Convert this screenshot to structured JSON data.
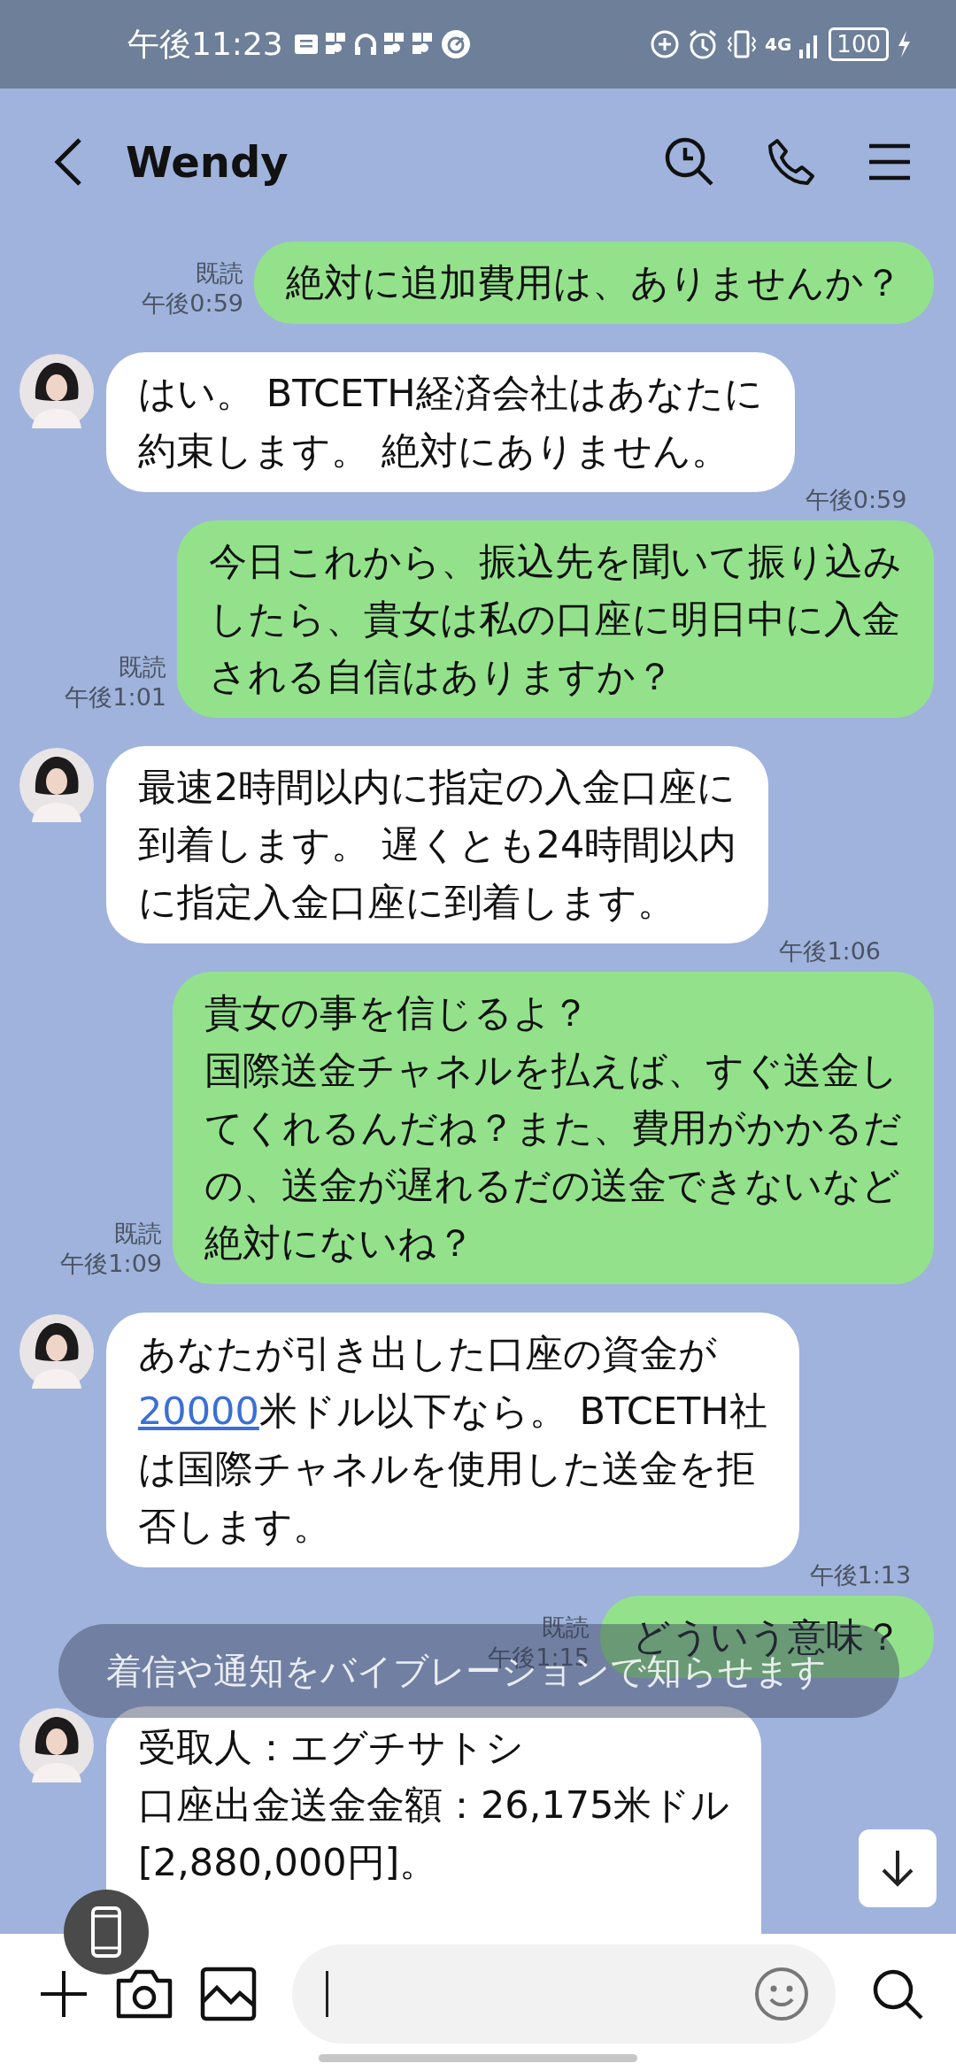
{
  "status_bar": {
    "time": "午後11:23",
    "network": "4G",
    "battery": "100"
  },
  "header": {
    "title": "Wendy"
  },
  "messages": [
    {
      "kind": "sent",
      "read": "既読",
      "time": "午後0:59",
      "lines": [
        [
          {
            "kind": "text",
            "text": "絶対に追加費用は、ありませんか？"
          }
        ]
      ]
    },
    {
      "kind": "received",
      "time": "午後0:59",
      "lines": [
        [
          {
            "kind": "text",
            "text": "はい。 BTCETH経済会社はあなたに"
          }
        ],
        [
          {
            "kind": "text",
            "text": "約束します。 絶対にありません。"
          }
        ]
      ]
    },
    {
      "kind": "sent",
      "read": "既読",
      "time": "午後1:01",
      "lines": [
        [
          {
            "kind": "text",
            "text": "今日これから、振込先を聞いて振り込み"
          }
        ],
        [
          {
            "kind": "text",
            "text": "したら、貴女は私の口座に明日中に入金"
          }
        ],
        [
          {
            "kind": "text",
            "text": "される自信はありますか？"
          }
        ]
      ]
    },
    {
      "kind": "received",
      "time": "午後1:06",
      "lines": [
        [
          {
            "kind": "text",
            "text": "最速2時間以内に指定の入金口座に"
          }
        ],
        [
          {
            "kind": "text",
            "text": "到着します。 遅くとも24時間以内"
          }
        ],
        [
          {
            "kind": "text",
            "text": "に指定入金口座に到着します。"
          }
        ]
      ]
    },
    {
      "kind": "sent",
      "read": "既読",
      "time": "午後1:09",
      "lines": [
        [
          {
            "kind": "text",
            "text": "貴女の事を信じるよ？"
          }
        ],
        [
          {
            "kind": "text",
            "text": "国際送金チャネルを払えば、すぐ送金し"
          }
        ],
        [
          {
            "kind": "text",
            "text": "てくれるんだね？また、費用がかかるだ"
          }
        ],
        [
          {
            "kind": "text",
            "text": "の、送金が遅れるだの送金できないなど"
          }
        ],
        [
          {
            "kind": "text",
            "text": "絶対にないね？"
          }
        ]
      ]
    },
    {
      "kind": "received",
      "time": "午後1:13",
      "lines": [
        [
          {
            "kind": "text",
            "text": "あなたが引き出した口座の資金が"
          }
        ],
        [
          {
            "kind": "link",
            "text": "20000"
          },
          {
            "kind": "text",
            "text": "米ドル以下なら。 BTCETH社"
          }
        ],
        [
          {
            "kind": "text",
            "text": "は国際チャネルを使用した送金を拒"
          }
        ],
        [
          {
            "kind": "text",
            "text": "否します。"
          }
        ]
      ]
    },
    {
      "kind": "sent",
      "read": "既読",
      "time": "午後1:15",
      "lines": [
        [
          {
            "kind": "text",
            "text": "どういう意味？"
          }
        ]
      ]
    },
    {
      "kind": "received",
      "lines": [
        [
          {
            "kind": "text",
            "text": "受取人：エグチサトシ"
          }
        ],
        [
          {
            "kind": "text",
            "text": "口座出金送金金額：26,175米ドル"
          }
        ],
        [
          {
            "kind": "text",
            "text": "[2,880,000円]。"
          }
        ]
      ]
    }
  ],
  "toast": {
    "text": "着信や通知をバイブレーションで知らせます"
  }
}
